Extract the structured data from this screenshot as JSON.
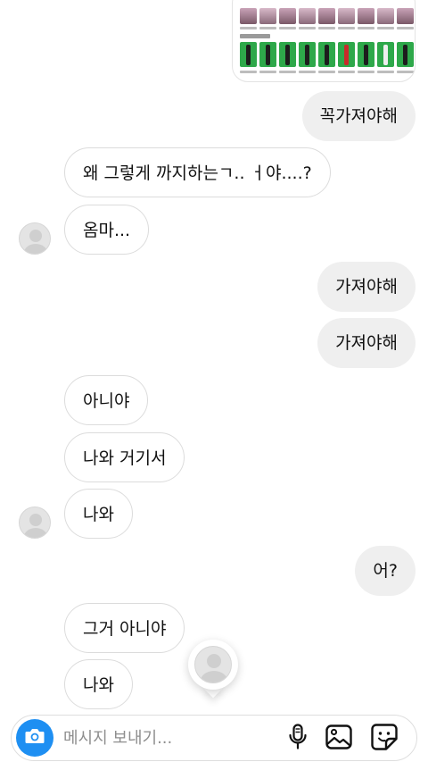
{
  "messages": [
    {
      "id": 1,
      "direction": "outgoing",
      "text": "꼭가져야해"
    },
    {
      "id": 2,
      "direction": "incoming",
      "text": "왜 그렇게 까지하는ㄱ.. ㅓ야....?"
    },
    {
      "id": 3,
      "direction": "incoming",
      "text": "옴마..."
    },
    {
      "id": 4,
      "direction": "outgoing",
      "text": "가져야해"
    },
    {
      "id": 5,
      "direction": "outgoing",
      "text": "가져야해"
    },
    {
      "id": 6,
      "direction": "incoming",
      "text": "아니야"
    },
    {
      "id": 7,
      "direction": "incoming",
      "text": "나와 거기서"
    },
    {
      "id": 8,
      "direction": "incoming",
      "text": "나와"
    },
    {
      "id": 9,
      "direction": "outgoing",
      "text": "어?"
    },
    {
      "id": 10,
      "direction": "incoming",
      "text": "그거 아니야"
    },
    {
      "id": 11,
      "direction": "incoming",
      "text": "나와"
    }
  ],
  "composer": {
    "placeholder": "메시지 보내기...",
    "icons": [
      "camera-icon",
      "microphone-icon",
      "gallery-icon",
      "sticker-icon"
    ]
  },
  "colors": {
    "accent": "#1e8ff2",
    "outgoing_bubble": "#efefef",
    "incoming_border": "#dcdcdc",
    "photo_background": "#2ea84a"
  }
}
